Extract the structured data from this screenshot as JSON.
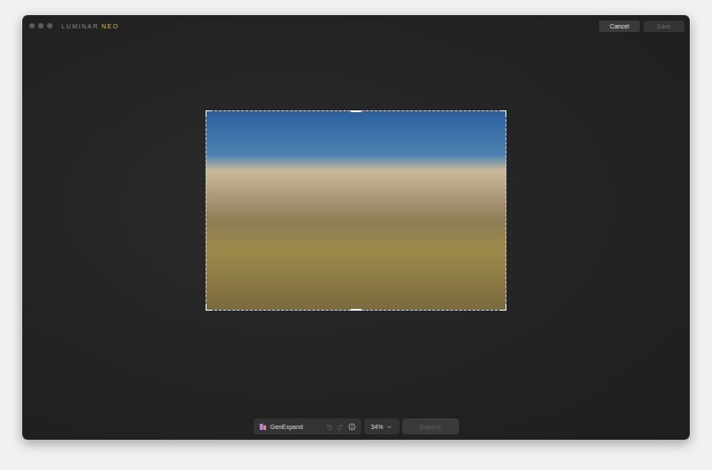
{
  "window": {
    "logo": {
      "brand": "LUMINAR",
      "product": "NEO"
    }
  },
  "header_buttons": [
    {
      "label": "Cancel",
      "disabled": false
    },
    {
      "label": "Save",
      "disabled": true
    }
  ],
  "tool": {
    "name": "GenExpand",
    "undo_disabled": true,
    "redo_disabled": true
  },
  "zoom": {
    "value": "34%"
  },
  "action_button": {
    "label": "Expand",
    "disabled": true
  }
}
